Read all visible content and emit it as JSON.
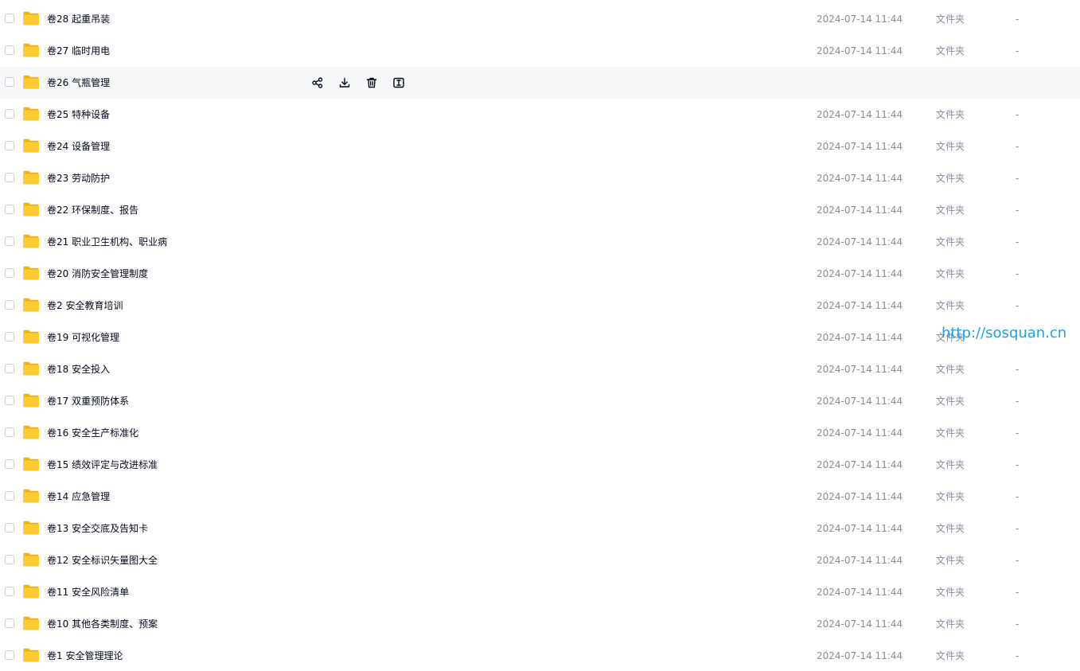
{
  "files": [
    {
      "name": "卷28 起重吊装",
      "date": "2024-07-14 11:44",
      "type": "文件夹",
      "size": "-"
    },
    {
      "name": "卷27 临时用电",
      "date": "2024-07-14 11:44",
      "type": "文件夹",
      "size": "-"
    },
    {
      "name": "卷26 气瓶管理",
      "date": "",
      "type": "",
      "size": ""
    },
    {
      "name": "卷25 特种设备",
      "date": "2024-07-14 11:44",
      "type": "文件夹",
      "size": "-"
    },
    {
      "name": "卷24 设备管理",
      "date": "2024-07-14 11:44",
      "type": "文件夹",
      "size": "-"
    },
    {
      "name": "卷23 劳动防护",
      "date": "2024-07-14 11:44",
      "type": "文件夹",
      "size": "-"
    },
    {
      "name": "卷22 环保制度、报告",
      "date": "2024-07-14 11:44",
      "type": "文件夹",
      "size": "-"
    },
    {
      "name": "卷21 职业卫生机构、职业病",
      "date": "2024-07-14 11:44",
      "type": "文件夹",
      "size": "-"
    },
    {
      "name": "卷20 消防安全管理制度",
      "date": "2024-07-14 11:44",
      "type": "文件夹",
      "size": "-"
    },
    {
      "name": "卷2 安全教育培训",
      "date": "2024-07-14 11:44",
      "type": "文件夹",
      "size": "-"
    },
    {
      "name": "卷19 可视化管理",
      "date": "2024-07-14 11:44",
      "type": "文件夹",
      "size": ""
    },
    {
      "name": "卷18 安全投入",
      "date": "2024-07-14 11:44",
      "type": "文件夹",
      "size": "-"
    },
    {
      "name": "卷17 双重预防体系",
      "date": "2024-07-14 11:44",
      "type": "文件夹",
      "size": "-"
    },
    {
      "name": "卷16 安全生产标准化",
      "date": "2024-07-14 11:44",
      "type": "文件夹",
      "size": "-"
    },
    {
      "name": "卷15 绩效评定与改进标准",
      "date": "2024-07-14 11:44",
      "type": "文件夹",
      "size": "-"
    },
    {
      "name": "卷14 应急管理",
      "date": "2024-07-14 11:44",
      "type": "文件夹",
      "size": "-"
    },
    {
      "name": "卷13 安全交底及告知卡",
      "date": "2024-07-14 11:44",
      "type": "文件夹",
      "size": "-"
    },
    {
      "name": "卷12 安全标识矢量图大全",
      "date": "2024-07-14 11:44",
      "type": "文件夹",
      "size": "-"
    },
    {
      "name": "卷11 安全风险清单",
      "date": "2024-07-14 11:44",
      "type": "文件夹",
      "size": "-"
    },
    {
      "name": "卷10 其他各类制度、预案",
      "date": "2024-07-14 11:44",
      "type": "文件夹",
      "size": "-"
    },
    {
      "name": "卷1 安全管理理论",
      "date": "2024-07-14 11:44",
      "type": "文件夹",
      "size": "-"
    }
  ],
  "hovered_row_index": 2,
  "row_actions": [
    "share-icon",
    "download-icon",
    "delete-icon",
    "rename-icon"
  ],
  "watermark": "http://sosquan.cn",
  "colors": {
    "folder_body": "#ffc933",
    "folder_tab": "#f5b300",
    "hover_bg": "#f7f8fa",
    "meta_text": "#878c9c",
    "watermark": "#1aa3e8"
  }
}
